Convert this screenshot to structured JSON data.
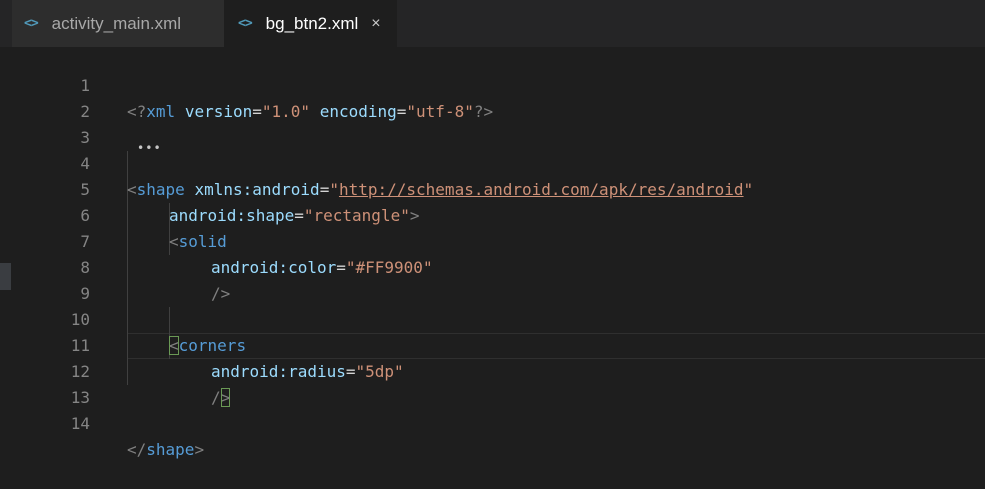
{
  "tabs": [
    {
      "icon": "<>",
      "label": "activity_main.xml",
      "active": false
    },
    {
      "icon": "<>",
      "label": "bg_btn2.xml",
      "active": true,
      "close": "×"
    }
  ],
  "editor": {
    "line_numbers": [
      "1",
      "2",
      "3",
      "4",
      "5",
      "6",
      "7",
      "8",
      "9",
      "10",
      "11",
      "12",
      "13",
      "14"
    ],
    "line1": {
      "open": "<?",
      "tag": "xml",
      "a1": "version",
      "eq": "=",
      "v1": "\"1.0\"",
      "a2": "encoding",
      "v2": "\"utf-8\"",
      "close": "?>"
    },
    "line4": {
      "open": "<",
      "tag": "shape",
      "attr": "xmlns:android",
      "eq": "=",
      "q1": "\"",
      "url": "http://schemas.android.com/apk/res/android",
      "q2": "\""
    },
    "line5": {
      "attr": "android:shape",
      "eq": "=",
      "val": "\"rectangle\"",
      "close": ">"
    },
    "line6": {
      "open": "<",
      "tag": "solid"
    },
    "line7": {
      "attr": "android:color",
      "eq": "=",
      "val": "\"#FF9900\""
    },
    "line8": {
      "close": "/>"
    },
    "line10": {
      "open": "<",
      "tag": "corners"
    },
    "line11": {
      "attr": "android:radius",
      "eq": "=",
      "val": "\"5dp\""
    },
    "line12": {
      "slash": "/",
      "gt": ">"
    },
    "line14": {
      "open": "</",
      "tag": "shape",
      "close": ">"
    }
  }
}
